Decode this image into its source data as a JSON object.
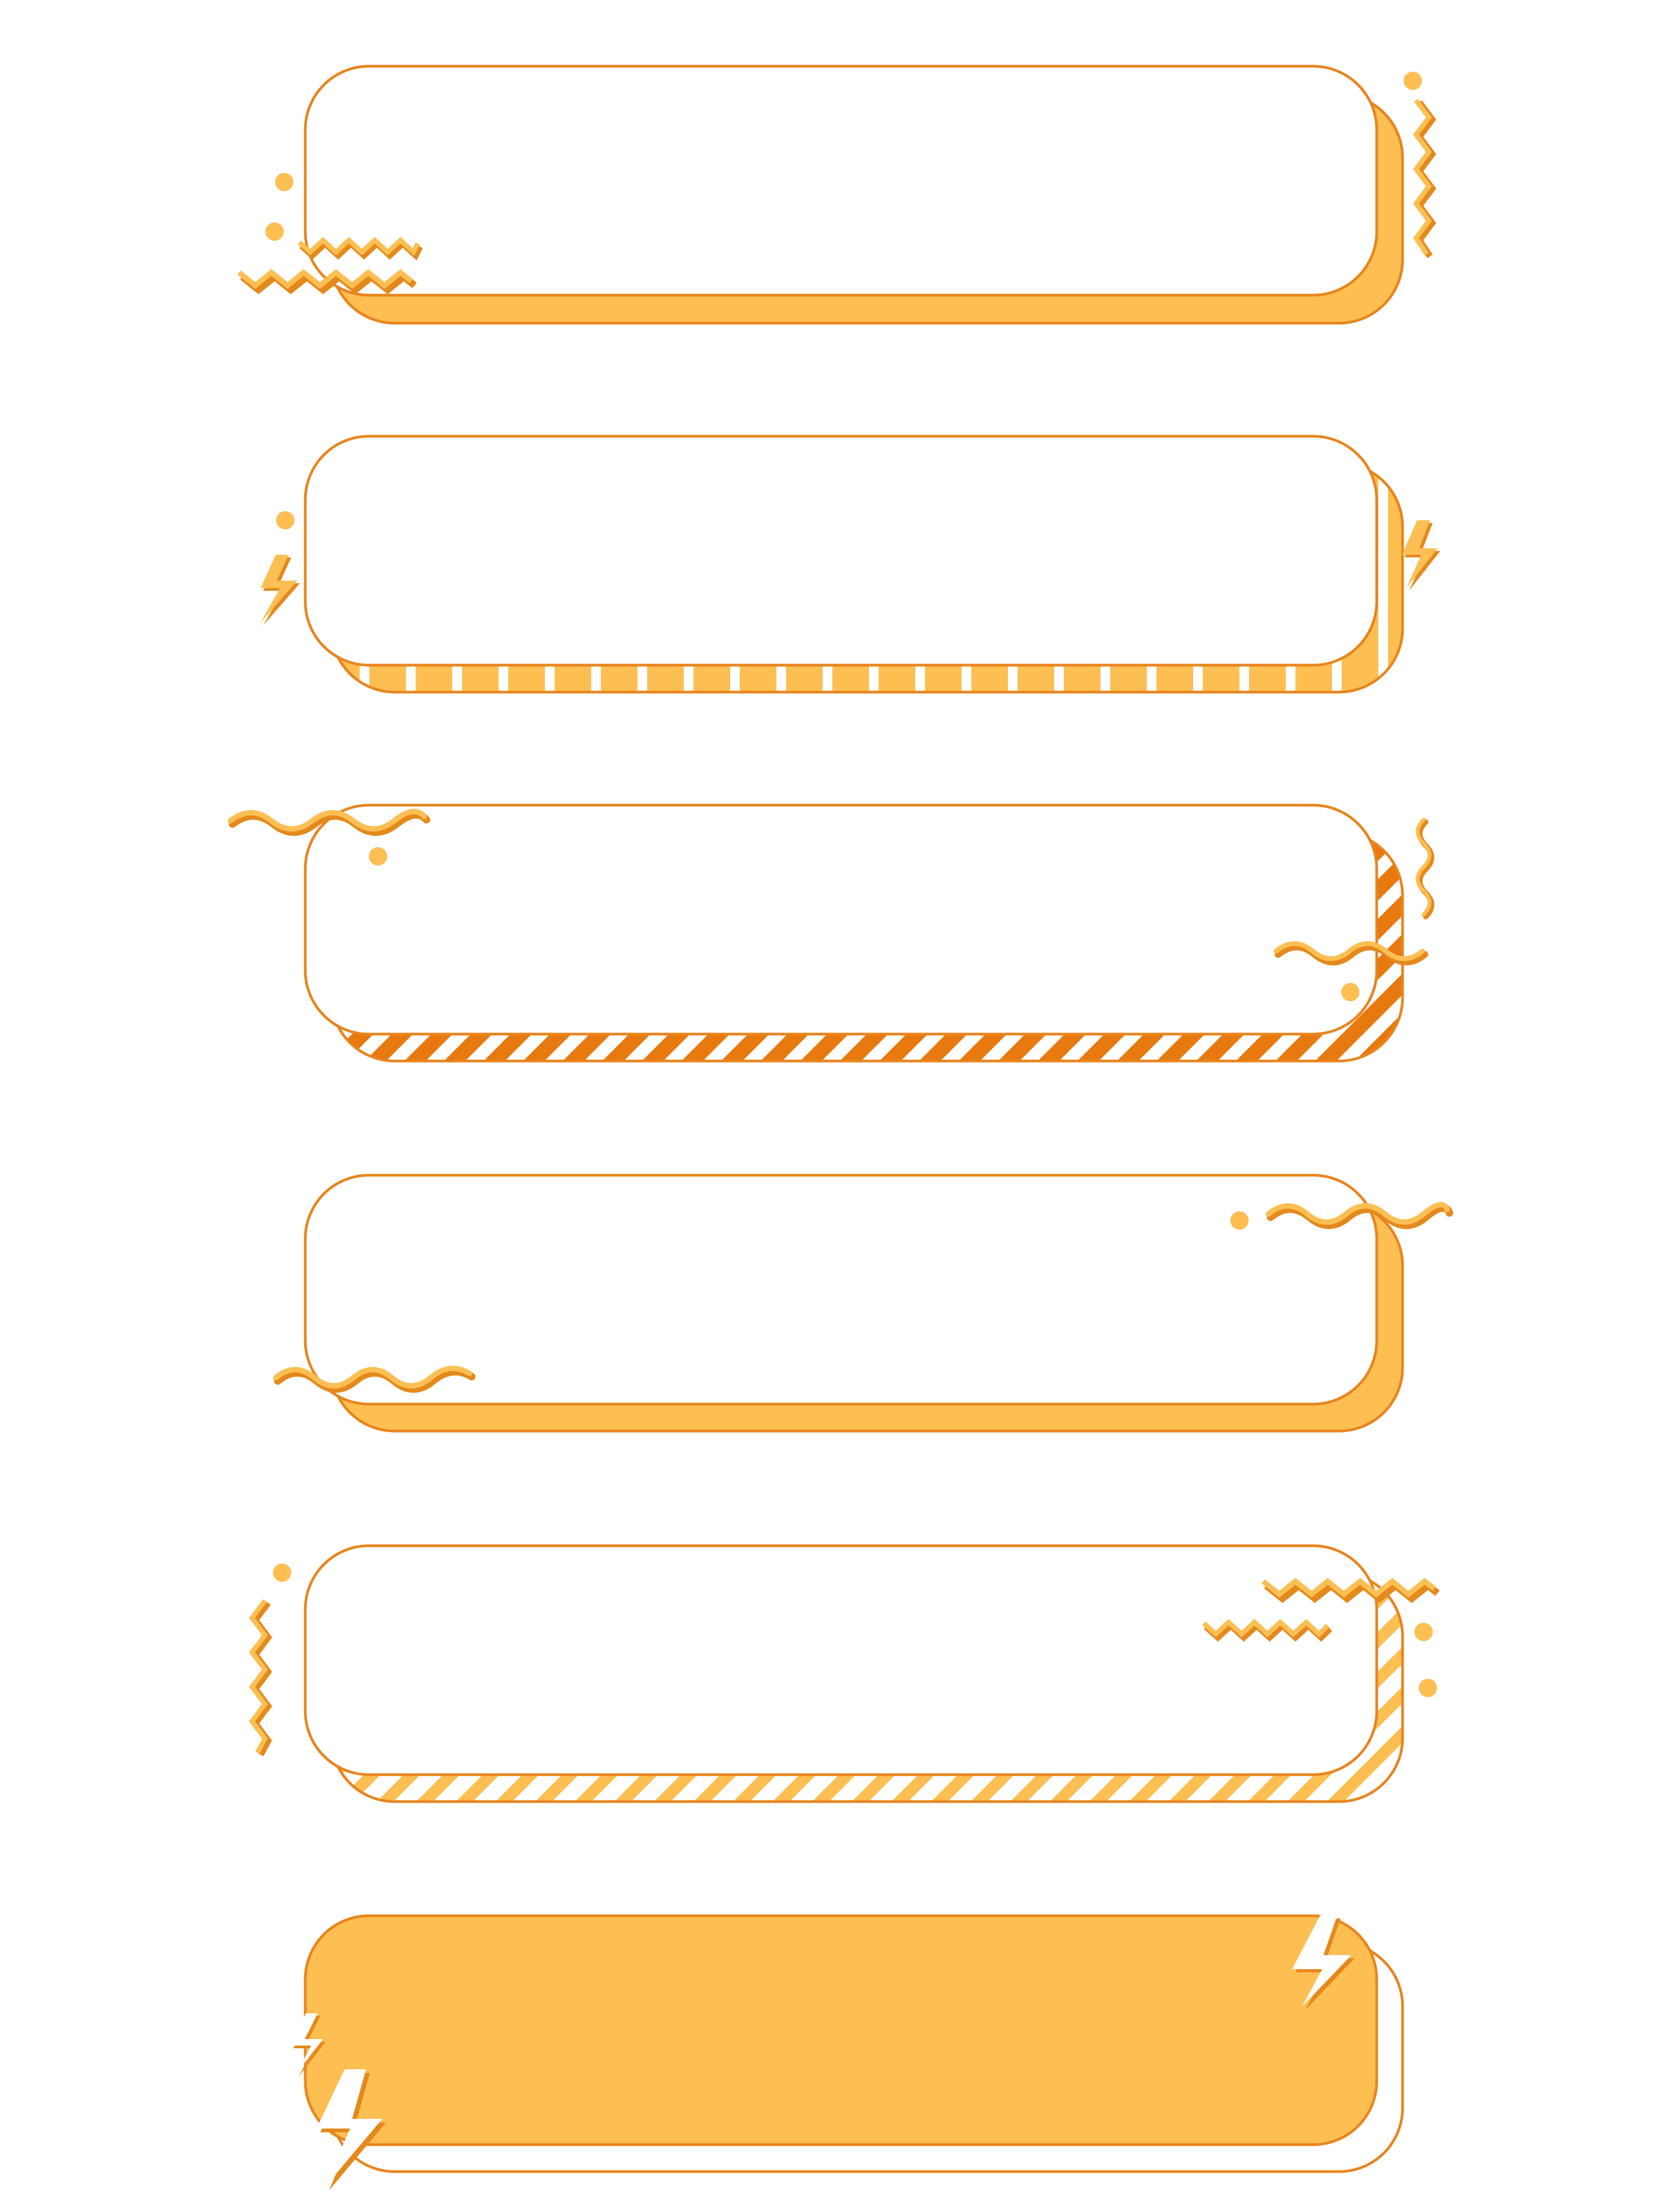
{
  "colors": {
    "background": "#ffffff",
    "outline": "#E8851E",
    "fill_light": "#FDBE52",
    "fill_dark": "#E8790E",
    "zigzag_light": "#FBBF53",
    "zigzag_shadow": "#E4891C",
    "white": "#ffffff"
  },
  "frames": [
    {
      "id": "frame-1",
      "shadow_style": "solid",
      "face_style": "blank",
      "decorations": [
        "dots",
        "zigzag",
        "zigzag-vertical"
      ]
    },
    {
      "id": "frame-2",
      "shadow_style": "vertical-stripes",
      "face_style": "blank",
      "decorations": [
        "dots",
        "lightning-bolt"
      ]
    },
    {
      "id": "frame-3",
      "shadow_style": "dark-diagonal-stripes",
      "face_style": "blank",
      "decorations": [
        "dots",
        "wave",
        "wave-vertical"
      ]
    },
    {
      "id": "frame-4",
      "shadow_style": "solid",
      "face_style": "blank",
      "decorations": [
        "dots",
        "wave"
      ]
    },
    {
      "id": "frame-5",
      "shadow_style": "light-diagonal-stripes",
      "face_style": "blank",
      "decorations": [
        "dots",
        "zigzag",
        "zigzag-vertical"
      ]
    },
    {
      "id": "frame-6",
      "shadow_style": "white",
      "face_style": "filled",
      "decorations": [
        "lightning-bolt"
      ]
    }
  ]
}
